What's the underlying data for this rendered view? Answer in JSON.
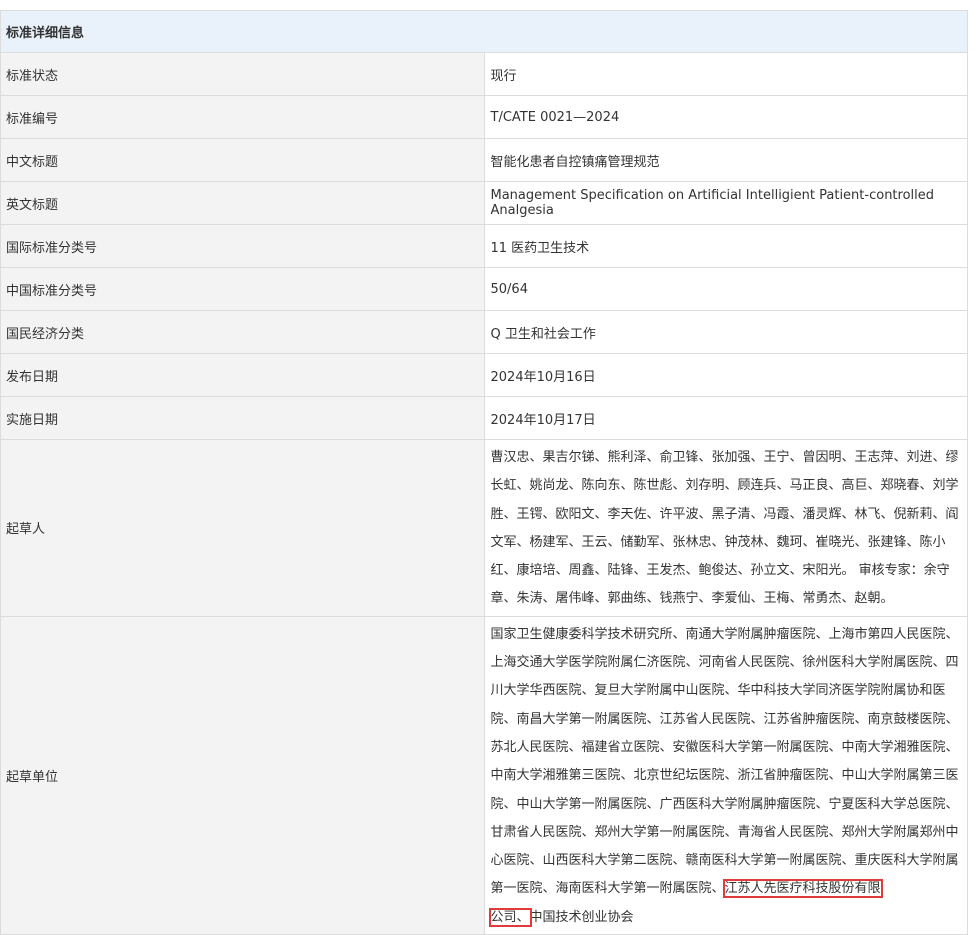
{
  "header": {
    "title": "标准详细信息"
  },
  "rows": [
    {
      "label": "标准状态",
      "value": "现行"
    },
    {
      "label": "标准编号",
      "value": "T/CATE 0021—2024"
    },
    {
      "label": "中文标题",
      "value": "智能化患者自控镇痛管理规范"
    },
    {
      "label": "英文标题",
      "value": "Management Specification on Artificial Intelligient Patient-controlled Analgesia"
    },
    {
      "label": "国际标准分类号",
      "value": "11 医药卫生技术"
    },
    {
      "label": "中国标准分类号",
      "value": "50/64"
    },
    {
      "label": "国民经济分类",
      "value": "Q 卫生和社会工作"
    },
    {
      "label": "发布日期",
      "value": "2024年10月16日"
    },
    {
      "label": "实施日期",
      "value": "2024年10月17日"
    }
  ],
  "drafters": {
    "label": "起草人",
    "value": "曹汉忠、果吉尔锑、熊利泽、俞卫锋、张加强、王宁、曾因明、王志萍、刘进、缪长虹、姚尚龙、陈向东、陈世彪、刘存明、顾连兵、马正良、高巨、郑晓春、刘学胜、王锷、欧阳文、李天佐、许平波、黑子清、冯霞、潘灵辉、林飞、倪新莉、阎文军、杨建军、王云、储勤军、张林忠、钟茂林、魏珂、崔晓光、张建锋、陈小红、康培培、周鑫、陆锋、王发杰、鲍俊达、孙立文、宋阳光。 审核专家：余守章、朱涛、屠伟峰、郭曲练、钱燕宁、李爱仙、王梅、常勇杰、赵朝。"
  },
  "units": {
    "label": "起草单位",
    "text_before": "国家卫生健康委科学技术研究所、南通大学附属肿瘤医院、上海市第四人民医院、上海交通大学医学院附属仁济医院、河南省人民医院、徐州医科大学附属医院、四川大学华西医院、复旦大学附属中山医院、华中科技大学同济医学院附属协和医院、南昌大学第一附属医院、江苏省人民医院、江苏省肿瘤医院、南京鼓楼医院、苏北人民医院、福建省立医院、安徽医科大学第一附属医院、中南大学湘雅医院、中南大学湘雅第三医院、北京世纪坛医院、浙江省肿瘤医院、中山大学附属第三医院、中山大学第一附属医院、广西医科大学附属肿瘤医院、宁夏医科大学总医院、甘肃省人民医院、郑州大学第一附属医院、青海省人民医院、郑州大学附属郑州中心医院、山西医科大学第二医院、赣南医科大学第一附属医院、重庆医科大学附属第一医院、海南医科大学第一附属医院、",
    "highlight_part1": "江苏人先医疗科技股份有限",
    "highlight_part2": "公司、",
    "text_after": "中国技术创业协会",
    "highlight_color": "#e03a3a"
  }
}
